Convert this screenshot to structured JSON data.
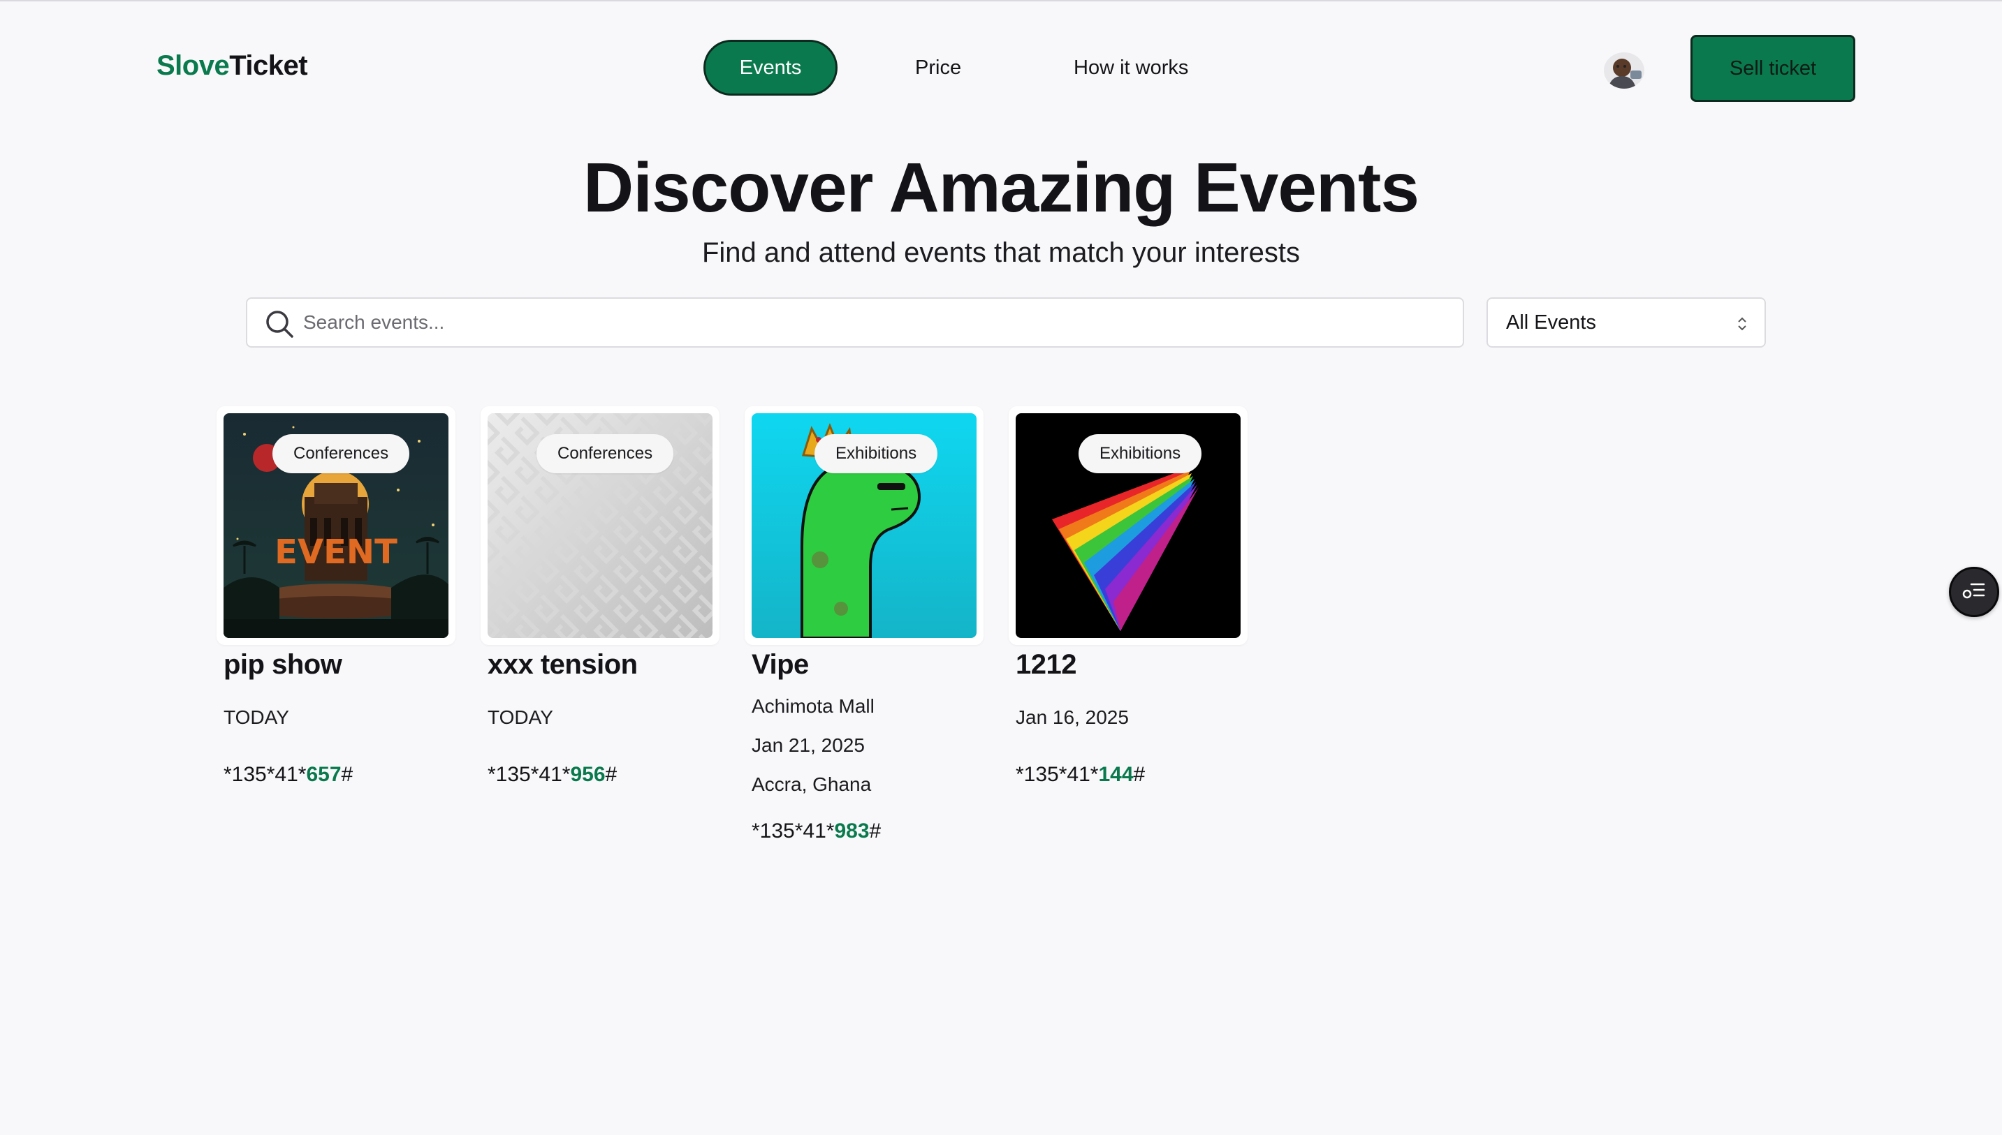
{
  "header": {
    "logo_part1": "Slove",
    "logo_part2": "Ticket",
    "nav": [
      {
        "label": "Events",
        "active": true
      },
      {
        "label": "Price",
        "active": false
      },
      {
        "label": "How it works",
        "active": false
      }
    ],
    "sell_button": "Sell ticket"
  },
  "hero": {
    "title": "Discover Amazing Events",
    "subtitle": "Find and attend events that match your interests"
  },
  "search": {
    "placeholder": "Search events...",
    "value": ""
  },
  "filter": {
    "selected": "All Events"
  },
  "events": [
    {
      "category": "Conferences",
      "title": "pip show",
      "lines": [
        "TODAY"
      ],
      "code_prefix": "*135*41*",
      "code_number": "657",
      "code_suffix": "#",
      "image": "event-poster-image"
    },
    {
      "category": "Conferences",
      "title": "xxx tension",
      "lines": [
        "TODAY"
      ],
      "code_prefix": "*135*41*",
      "code_number": "956",
      "code_suffix": "#",
      "image": "maze-placeholder-image"
    },
    {
      "category": "Exhibitions",
      "title": "Vipe",
      "lines": [
        "Achimota Mall",
        "Jan 21, 2025",
        "Accra, Ghana"
      ],
      "code_prefix": "*135*41*",
      "code_number": "983",
      "code_suffix": "#",
      "image": "green-dino-image"
    },
    {
      "category": "Exhibitions",
      "title": "1212",
      "lines": [
        "Jan 16, 2025"
      ],
      "code_prefix": "*135*41*",
      "code_number": "144",
      "code_suffix": "#",
      "image": "rainbow-prism-image"
    }
  ],
  "icons": {
    "search": "search-icon",
    "filter_chevron": "chevron-up-down-icon",
    "floating": "menu-list-icon"
  },
  "colors": {
    "brand": "#0a7a4e",
    "text": "#141418",
    "background": "#f8f8fa"
  }
}
